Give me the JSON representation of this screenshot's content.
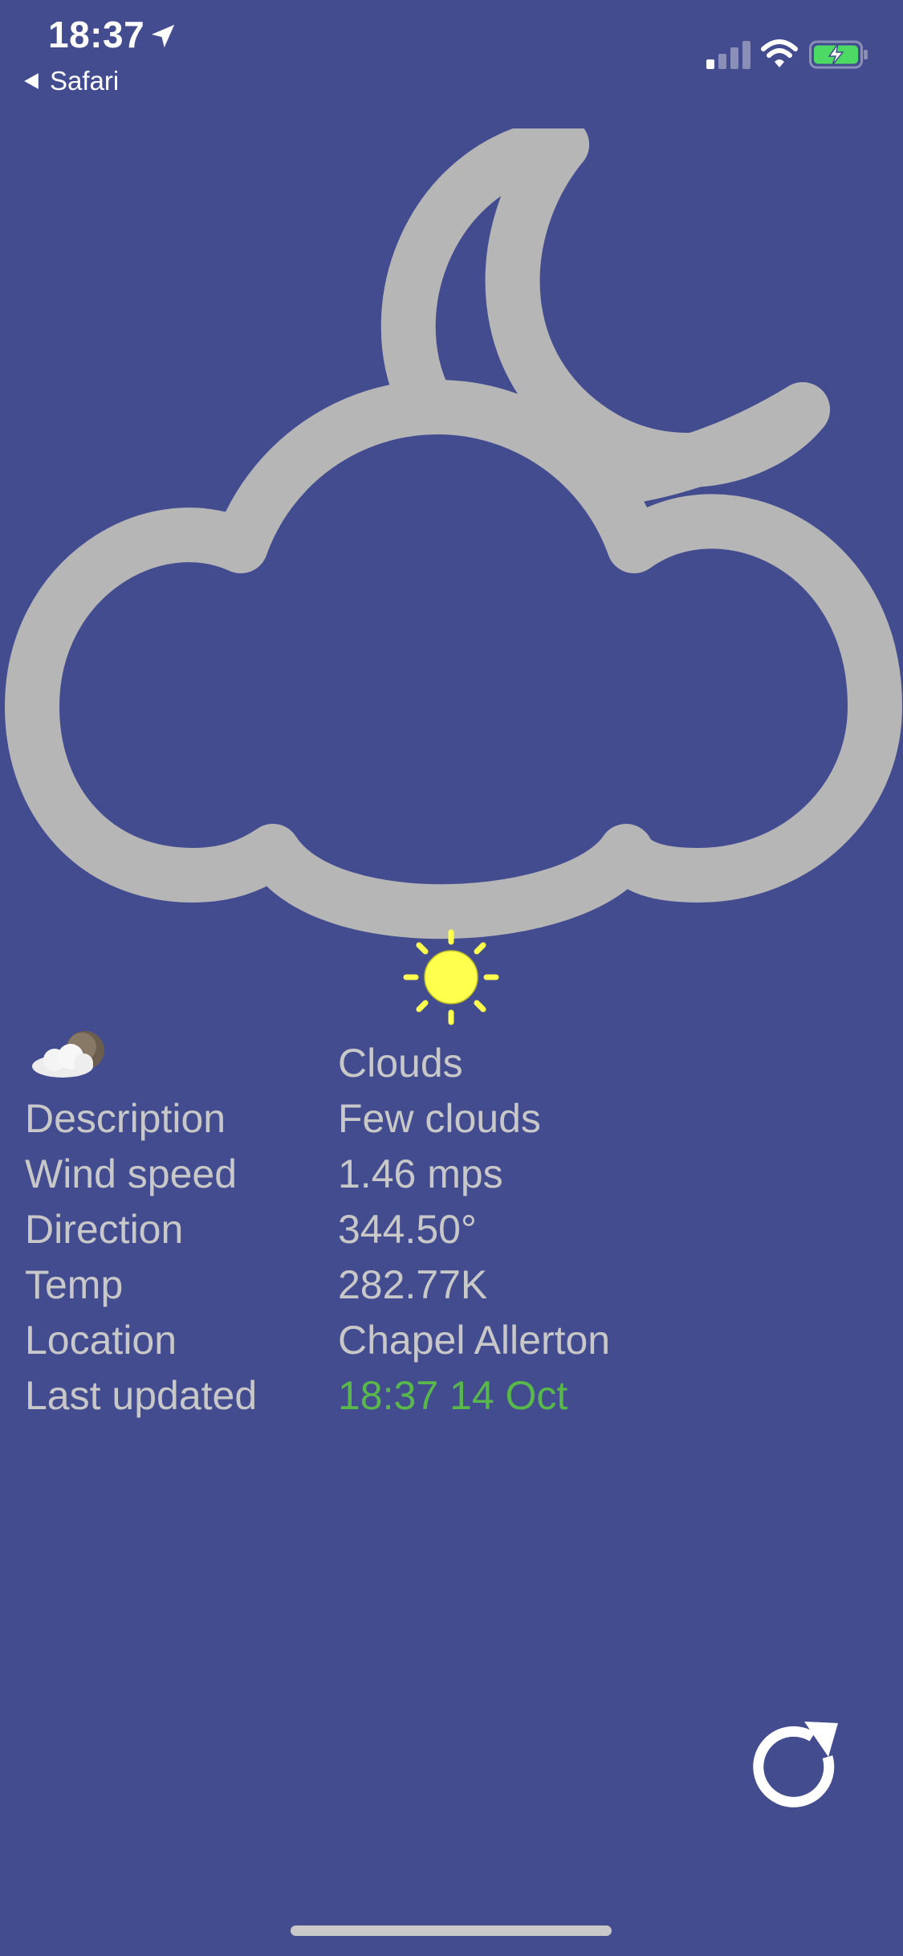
{
  "status_bar": {
    "time": "18:37",
    "back_label": "Safari",
    "icons": [
      "location-arrow-icon",
      "cellular-signal-icon",
      "wifi-icon",
      "battery-charging-icon"
    ],
    "battery_color": "#4cd964"
  },
  "hero": {
    "icon": "cloud-moon-icon",
    "icon_color": "#b6b6b6",
    "sun_icon": "sun-icon",
    "sun_color": "#ffff4d"
  },
  "weather": {
    "small_icon": "cloud-night-icon",
    "rows": [
      {
        "label": "",
        "value": "Clouds"
      },
      {
        "label": "Description",
        "value": "Few clouds"
      },
      {
        "label": "Wind speed",
        "value": "1.46 mps"
      },
      {
        "label": "Direction",
        "value": "344.50°"
      },
      {
        "label": "Temp",
        "value": "282.77K"
      },
      {
        "label": "Location",
        "value": "Chapel Allerton"
      },
      {
        "label": "Last updated",
        "value": "18:37 14 Oct"
      }
    ],
    "updated_color": "#59b84a"
  },
  "actions": {
    "refresh_icon": "refresh-icon"
  },
  "theme": {
    "background": "#434c8f",
    "text": "#c8c8c8"
  }
}
